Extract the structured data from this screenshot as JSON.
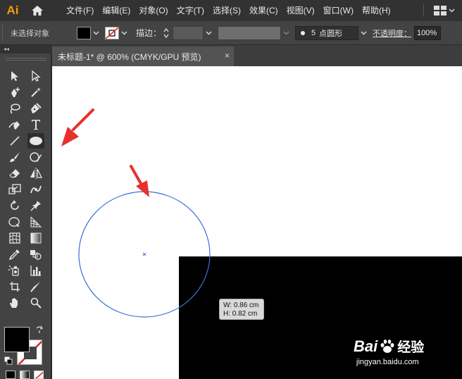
{
  "app": {
    "logo": "Ai"
  },
  "menu": [
    "文件(F)",
    "编辑(E)",
    "对象(O)",
    "文字(T)",
    "选择(S)",
    "效果(C)",
    "视图(V)",
    "窗口(W)",
    "帮助(H)"
  ],
  "control_bar": {
    "selection_status": "未选择对象",
    "stroke_label": "描边：",
    "brush_size": "5",
    "brush_name": "点圆形",
    "opacity_label": "不透明度：",
    "opacity_value": "100%"
  },
  "document_tab": {
    "title": "未标题-1* @ 600% (CMYK/GPU 预览)",
    "close": "×"
  },
  "canvas": {
    "tooltip_width": "W: 0.86 cm",
    "tooltip_height": "H: 0.82 cm",
    "selected_tool": "ellipse-tool",
    "ellipse_color": "#3b6fd8",
    "arrow_color": "#e8302f"
  },
  "watermark": {
    "logo": "Bai",
    "logo_suffix": "经验",
    "url": "jingyan.baidu.com"
  },
  "colors": {
    "menubar": "#323232",
    "panel": "#434343",
    "accent_logo": "#ff9a00"
  }
}
